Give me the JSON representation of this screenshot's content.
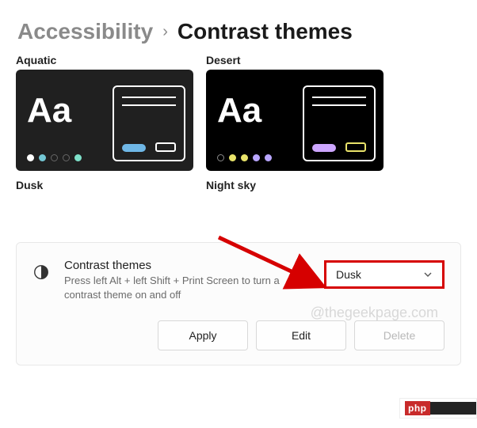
{
  "breadcrumb": {
    "parent": "Accessibility",
    "current": "Contrast themes"
  },
  "themes": [
    {
      "name": "Aquatic",
      "sample": "Aa",
      "bg": "#202020",
      "dots": [
        "#ffffff",
        "#73c7d4",
        "#2b2b2b",
        "#2b2b2b",
        "#7ee0c9"
      ],
      "pill": "#6fb7e6",
      "btn_border": "#ffffff"
    },
    {
      "name": "Desert",
      "sample": "Aa",
      "bg": "#000000",
      "dots": [
        "#ffffff",
        "#e9e36a",
        "#e9e36a",
        "#b9a6ff",
        "#b9a6ff"
      ],
      "pill": "#cda6ff",
      "btn_border": "#e9e36a"
    }
  ],
  "theme_labels": {
    "left": "Dusk",
    "right": "Night sky"
  },
  "card": {
    "title": "Contrast themes",
    "description": "Press left Alt + left Shift + Print Screen to turn a contrast theme on and off",
    "dropdown_value": "Dusk"
  },
  "buttons": {
    "apply": "Apply",
    "edit": "Edit",
    "delete": "Delete"
  },
  "watermark": "@thegeekpage.com",
  "badge": "php"
}
